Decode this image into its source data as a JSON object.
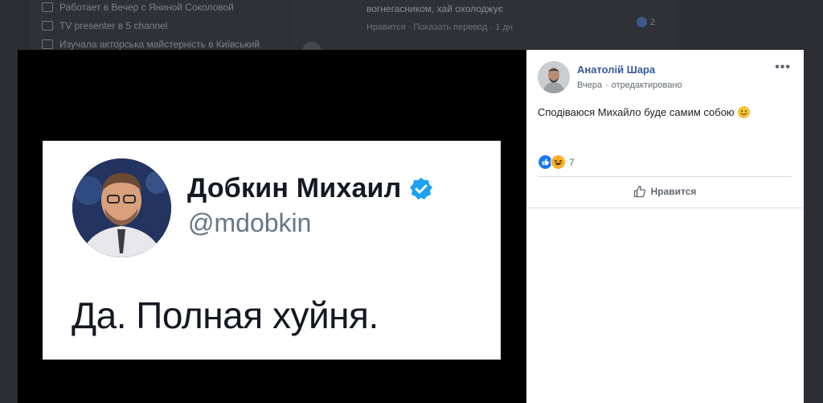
{
  "background": {
    "profile_rows": [
      "Работает в Вечер с Яниной Соколовой",
      "TV presenter в 5 channel",
      "Изучала акторська майстерність в Київський"
    ],
    "comment_text": "вогнегасником, хай охолоджує",
    "comment_meta": "Нравится · Показать перевод · 1 дн",
    "comment_like_count": "2"
  },
  "tweet": {
    "name": "Добкин Михаил",
    "handle": "@mdobkin",
    "text": "Да. Полная хуйня."
  },
  "post": {
    "author": "Анатолій Шара",
    "time": "Вчера",
    "edited": "отредактировано",
    "separator": "·",
    "text": "Сподіваюся Михайло буде самим собою",
    "reaction_count": "7",
    "like_label": "Нравится",
    "more_label": "•••"
  },
  "colors": {
    "link_blue": "#365899",
    "like_blue": "#1877f2",
    "haha_yellow": "#f7b125",
    "verified_blue": "#1da1f2"
  }
}
